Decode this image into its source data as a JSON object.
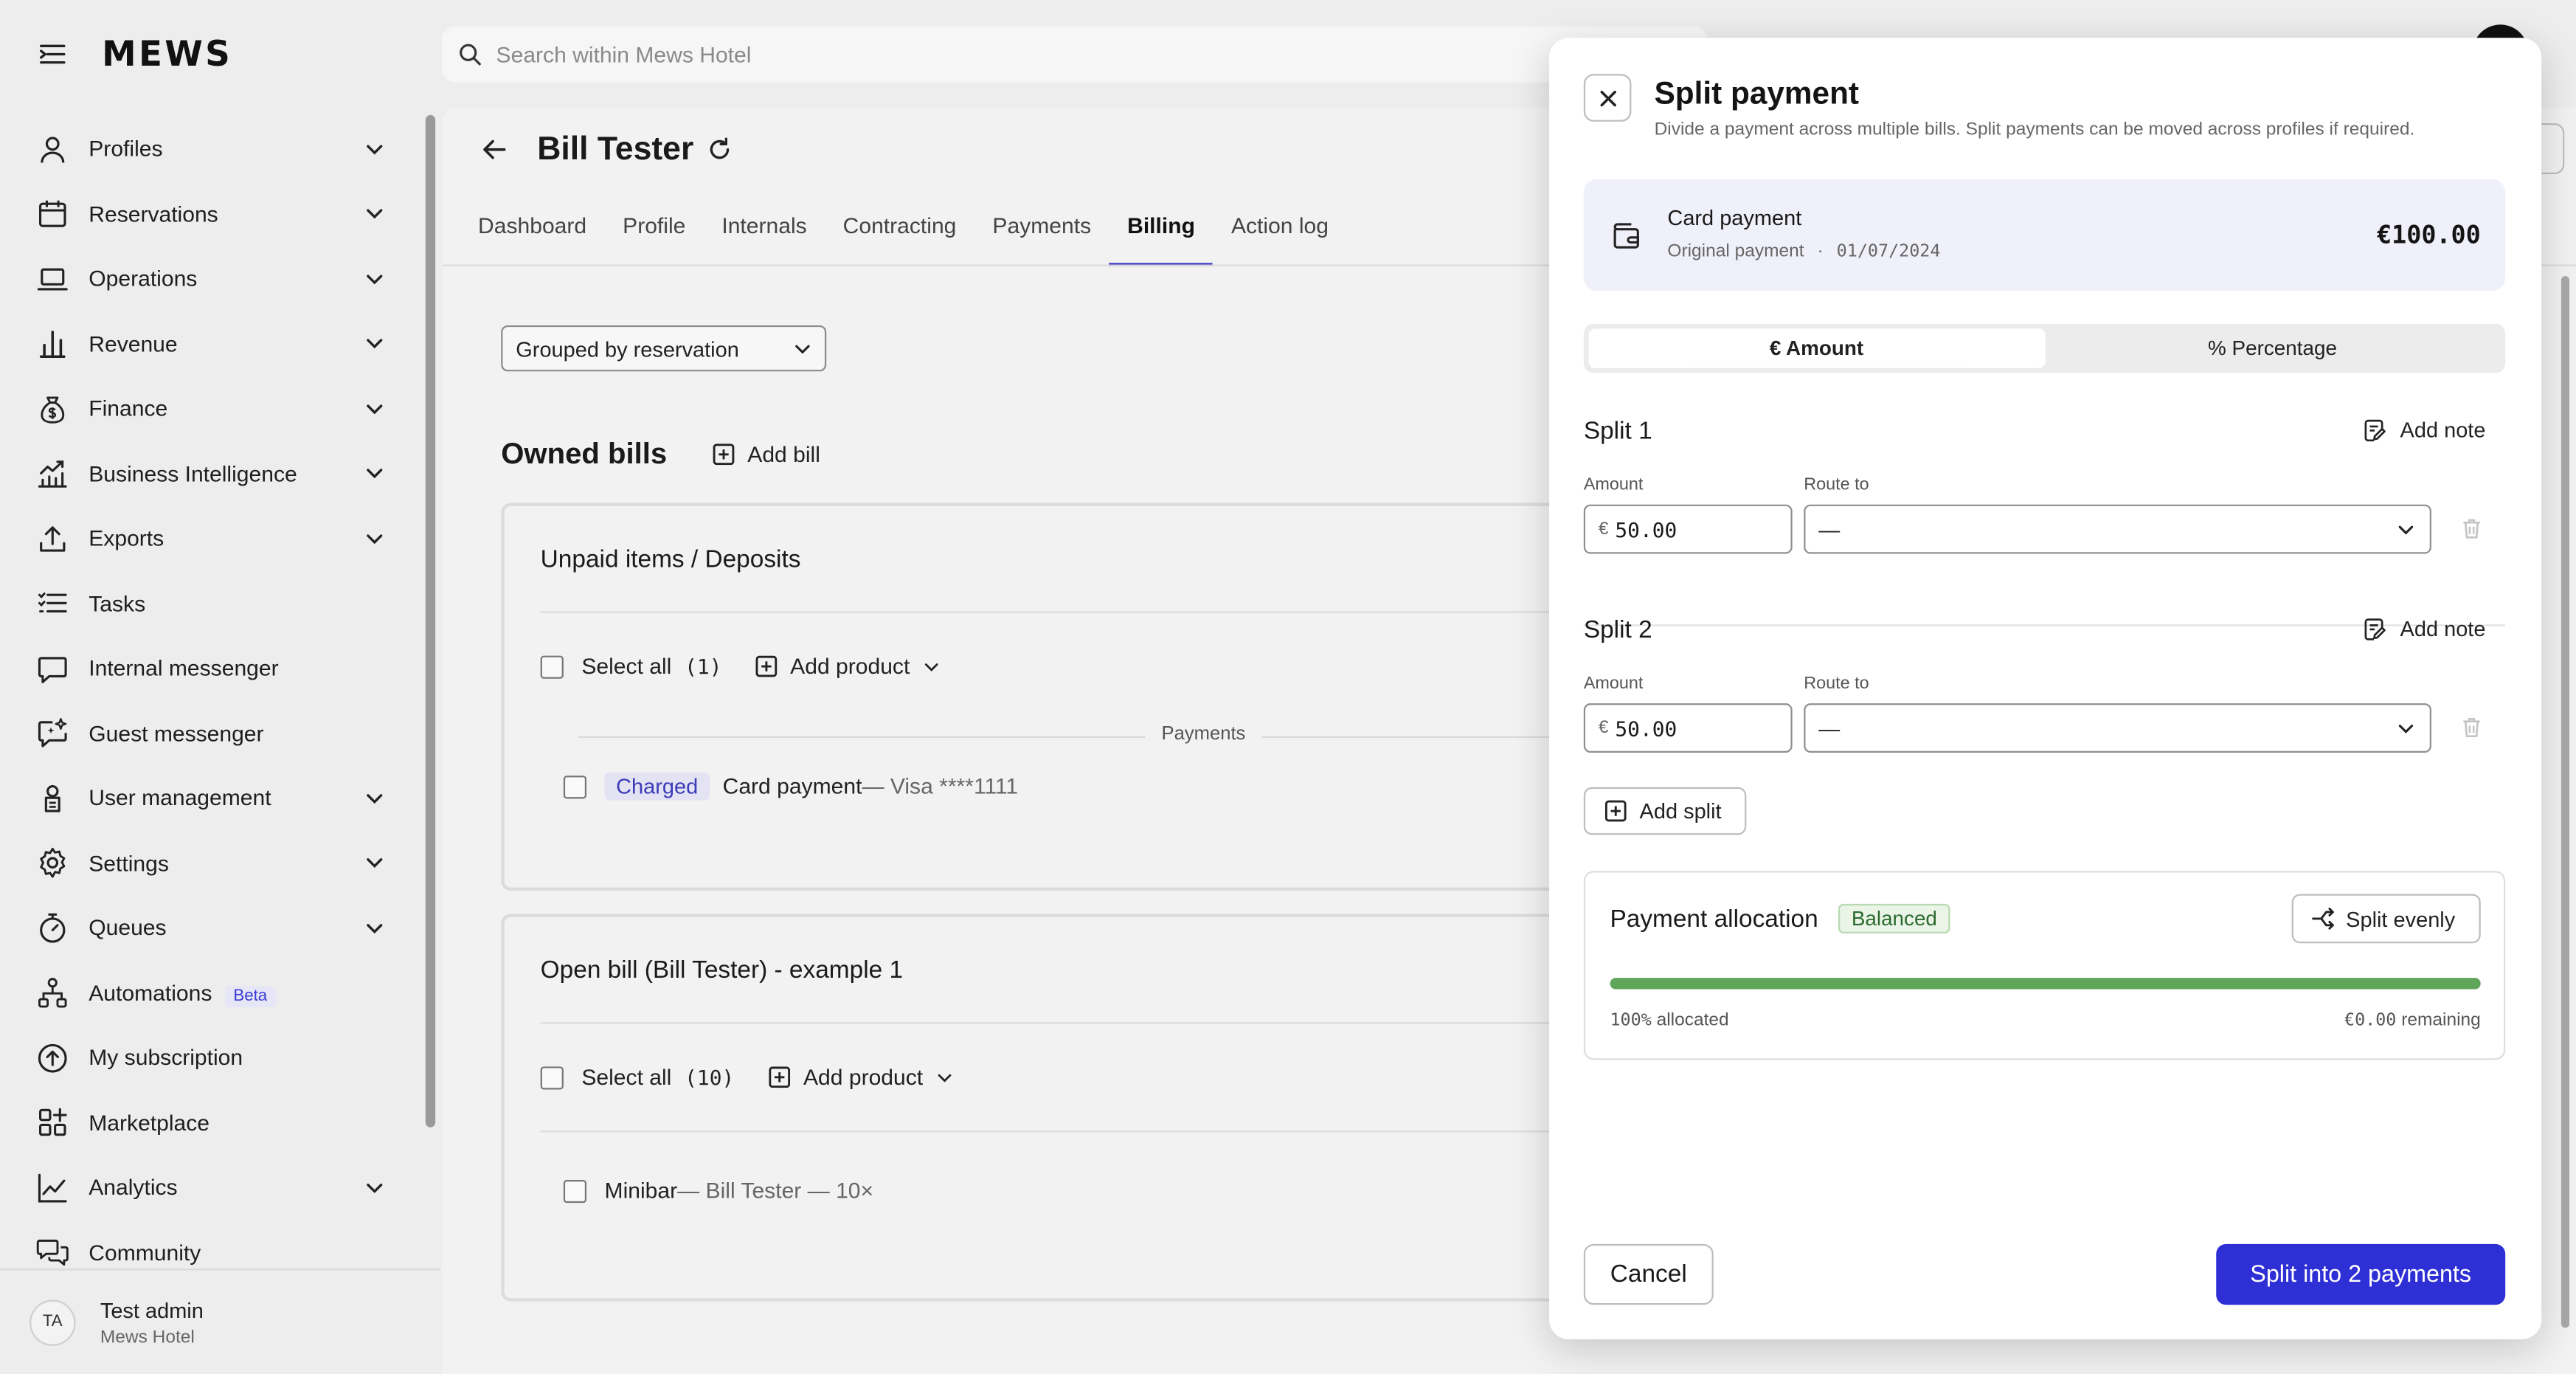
{
  "app": {
    "logo": "MEWS"
  },
  "search": {
    "placeholder": "Search within Mews Hotel"
  },
  "sidebar": {
    "items": [
      {
        "label": "Profiles",
        "icon": "person-icon",
        "expandable": true
      },
      {
        "label": "Reservations",
        "icon": "calendar-icon",
        "expandable": true
      },
      {
        "label": "Operations",
        "icon": "laptop-icon",
        "expandable": true
      },
      {
        "label": "Revenue",
        "icon": "bar-chart-icon",
        "expandable": true
      },
      {
        "label": "Finance",
        "icon": "money-bag-icon",
        "expandable": true
      },
      {
        "label": "Business Intelligence",
        "icon": "trend-chart-icon",
        "expandable": true
      },
      {
        "label": "Exports",
        "icon": "upload-icon",
        "expandable": true
      },
      {
        "label": "Tasks",
        "icon": "list-icon",
        "expandable": false
      },
      {
        "label": "Internal messenger",
        "icon": "chat-icon",
        "expandable": false
      },
      {
        "label": "Guest messenger",
        "icon": "sparkle-chat-icon",
        "expandable": false
      },
      {
        "label": "User management",
        "icon": "user-badge-icon",
        "expandable": true
      },
      {
        "label": "Settings",
        "icon": "gear-icon",
        "expandable": true
      },
      {
        "label": "Queues",
        "icon": "timer-icon",
        "expandable": true
      },
      {
        "label": "Automations",
        "icon": "flow-icon",
        "expandable": false,
        "badge": "Beta"
      },
      {
        "label": "My subscription",
        "icon": "arrow-circle-icon",
        "expandable": false
      },
      {
        "label": "Marketplace",
        "icon": "grid-plus-icon",
        "expandable": false
      },
      {
        "label": "Analytics",
        "icon": "line-chart-icon",
        "expandable": true
      },
      {
        "label": "Community",
        "icon": "chats-icon",
        "expandable": false
      }
    ],
    "user": {
      "initials": "TA",
      "name": "Test admin",
      "hotel": "Mews Hotel"
    }
  },
  "page": {
    "title": "Bill Tester",
    "tabs": [
      "Dashboard",
      "Profile",
      "Internals",
      "Contracting",
      "Payments",
      "Billing",
      "Action log"
    ],
    "active_tab": "Billing",
    "grouping": "Grouped by reservation",
    "owned_bills_title": "Owned bills",
    "add_bill": "Add bill",
    "bills": [
      {
        "title": "Unpaid items / Deposits",
        "select_all": "Select all",
        "count": "(1)",
        "add_product": "Add product",
        "section_label": "Payments",
        "item": {
          "badge": "Charged",
          "name": "Card payment",
          "detail": " — Visa ****1111"
        }
      },
      {
        "title": "Open bill (Bill Tester) - example 1",
        "select_all": "Select all",
        "count": "(10)",
        "add_product": "Add product",
        "item": {
          "name": "Minibar",
          "detail": " — Bill Tester — 10×"
        }
      }
    ]
  },
  "modal": {
    "title": "Split payment",
    "subtitle": "Divide a payment across multiple bills. Split payments can be moved across profiles if required.",
    "payment": {
      "name": "Card payment",
      "meta_label": "Original payment",
      "meta_sep": "·",
      "date": "01/07/2024",
      "amount": "€100.00"
    },
    "modes": [
      "€ Amount",
      "% Percentage"
    ],
    "active_mode": "€ Amount",
    "splits": [
      {
        "title": "Split 1",
        "add_note": "Add note",
        "amount_label": "Amount",
        "currency": "€",
        "amount": "50.00",
        "route_label": "Route to",
        "route": "—"
      },
      {
        "title": "Split 2",
        "add_note": "Add note",
        "amount_label": "Amount",
        "currency": "€",
        "amount": "50.00",
        "route_label": "Route to",
        "route": "—"
      }
    ],
    "add_split": "Add split",
    "allocation": {
      "title": "Payment allocation",
      "status": "Balanced",
      "split_evenly": "Split evenly",
      "allocated_pct": 100,
      "allocated_num": "100%",
      "allocated_text": " allocated",
      "remaining_num": "€0.00",
      "remaining_text": " remaining"
    },
    "cancel": "Cancel",
    "submit": "Split into 2 payments"
  },
  "colors": {
    "accent": "#2f2fd6",
    "success": "#5fa55a",
    "tab_underline": "#3939c4"
  }
}
